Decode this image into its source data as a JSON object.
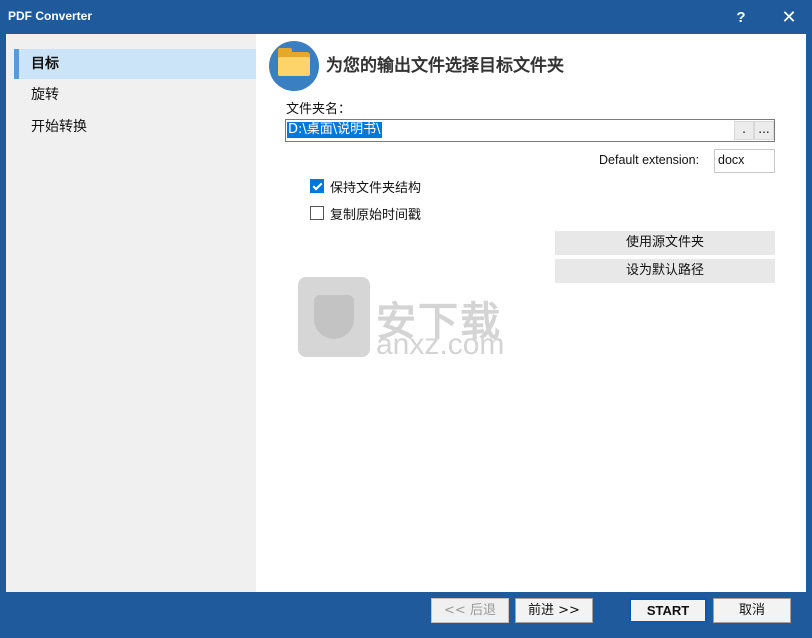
{
  "window": {
    "title": "PDF Converter",
    "help_label": "?",
    "close_label": "✕"
  },
  "sidebar": {
    "items": [
      {
        "label": "目标",
        "active": true
      },
      {
        "label": "旋转",
        "active": false
      },
      {
        "label": "开始转换",
        "active": false
      }
    ]
  },
  "header": {
    "title": "为您的输出文件选择目标文件夹",
    "icon": "folder-icon"
  },
  "folder": {
    "label": "文件夹名：",
    "value": "D:\\桌面\\说明书\\",
    "dot_button": ".",
    "browse_button": "..."
  },
  "extension": {
    "label": "Default extension:",
    "value": "docx"
  },
  "options": {
    "keep_structure": {
      "label": "保持文件夹结构",
      "checked": true
    },
    "copy_timestamp": {
      "label": "复制原始时间戳",
      "checked": false
    }
  },
  "side_buttons": {
    "use_source": "使用源文件夹",
    "set_default": "设为默认路径"
  },
  "watermark": {
    "cn": "安下载",
    "en": "anxz.com"
  },
  "footer": {
    "back": "<< 后退",
    "next": "前进 >>",
    "start": "START",
    "cancel": "取消"
  },
  "colors": {
    "titlebar": "#1e5a9c",
    "accent": "#0078d7",
    "nav_active": "#cce4f7"
  }
}
